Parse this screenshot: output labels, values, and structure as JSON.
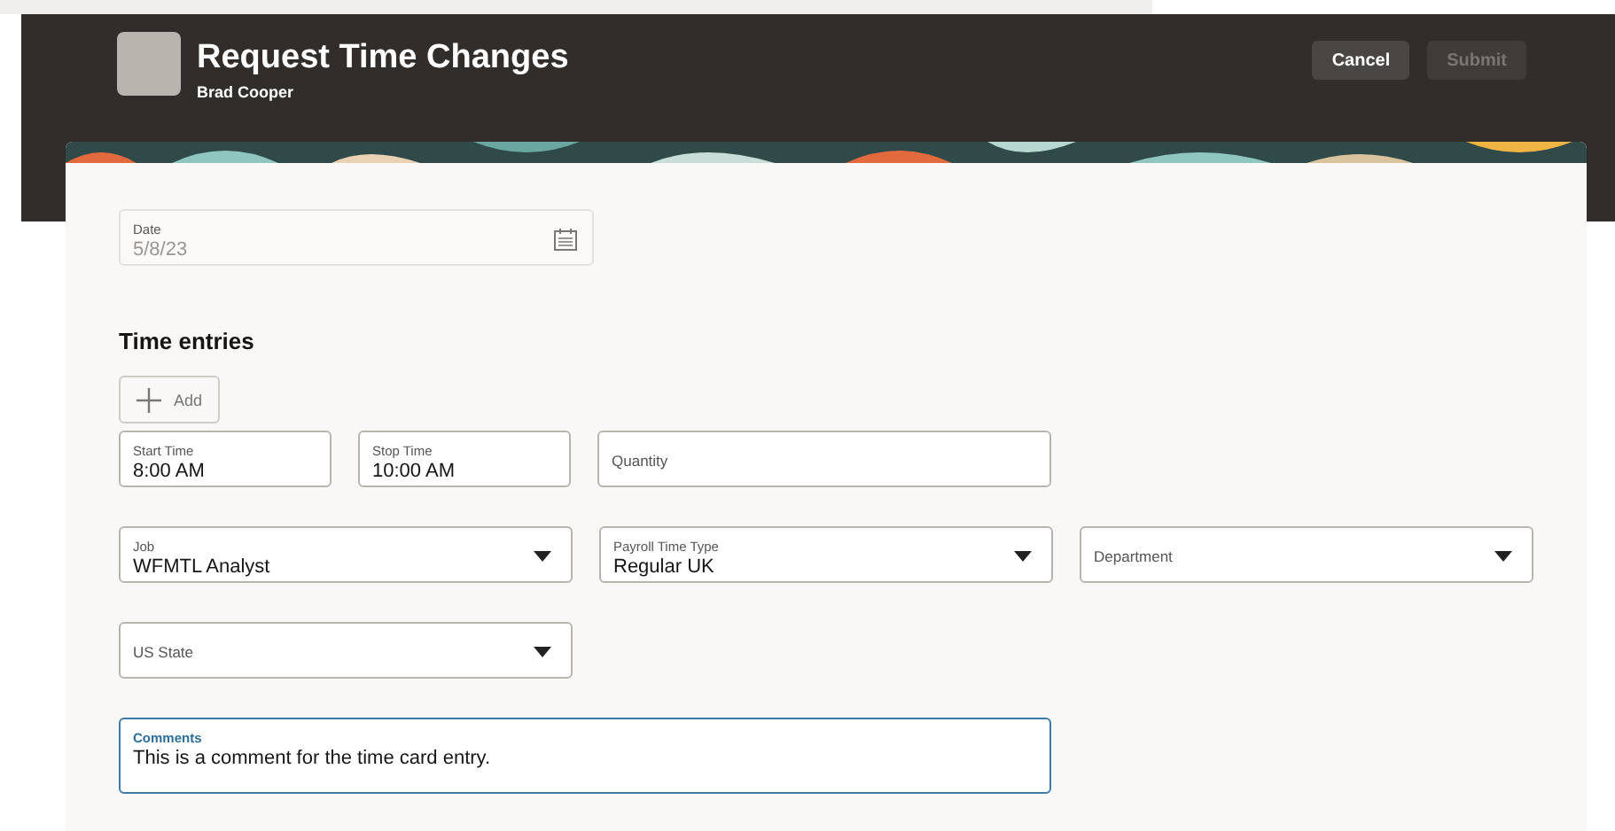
{
  "header": {
    "title": "Request Time Changes",
    "subtitle": "Brad Cooper",
    "buttons": [
      {
        "label": "Cancel",
        "disabled": false
      },
      {
        "label": "Submit",
        "disabled": true
      }
    ]
  },
  "date_field": {
    "label": "Date",
    "value": "5/8/23",
    "disabled": true
  },
  "section_title": "Time entries",
  "add_button": {
    "label": "Add"
  },
  "rows": [
    [
      {
        "kind": "time",
        "label": "Start Time",
        "value": "8:00 AM"
      },
      {
        "kind": "time",
        "label": "Stop Time",
        "value": "10:00 AM"
      },
      {
        "kind": "text",
        "label": "Quantity"
      }
    ],
    [
      {
        "kind": "select",
        "label": "Job",
        "value": "WFMTL Analyst"
      },
      {
        "kind": "select",
        "label": "Payroll Time Type",
        "value": "Regular UK"
      },
      {
        "kind": "select",
        "label": "Department"
      }
    ],
    [
      {
        "kind": "select",
        "label": "US State"
      }
    ],
    [
      {
        "kind": "comment",
        "label": "Comments",
        "value": "This is a comment for the time card entry.",
        "focused": true
      }
    ]
  ]
}
